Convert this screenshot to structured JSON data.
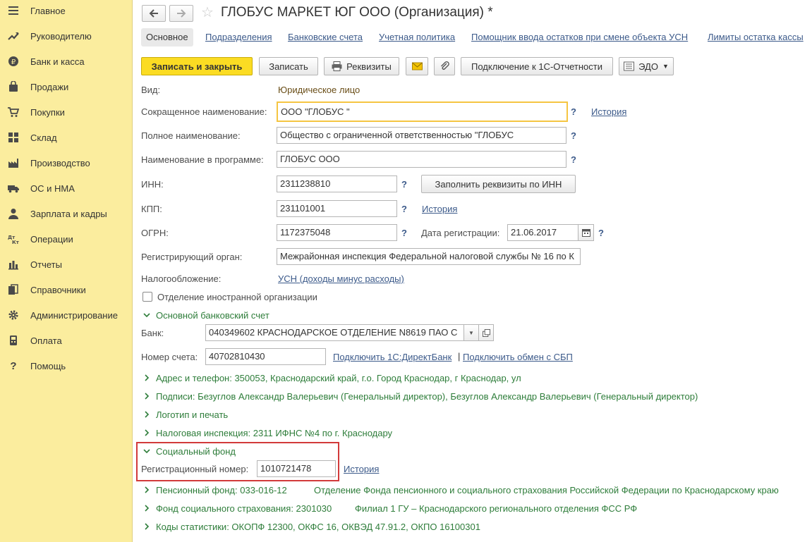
{
  "sidebar": {
    "items": [
      {
        "label": "Главное",
        "icon": "menu-icon"
      },
      {
        "label": "Руководителю",
        "icon": "trend-icon"
      },
      {
        "label": "Банк и касса",
        "icon": "ruble-coin-icon"
      },
      {
        "label": "Продажи",
        "icon": "shopping-bag-icon"
      },
      {
        "label": "Покупки",
        "icon": "cart-icon"
      },
      {
        "label": "Склад",
        "icon": "warehouse-grid-icon"
      },
      {
        "label": "Производство",
        "icon": "factory-icon"
      },
      {
        "label": "ОС и НМА",
        "icon": "truck-icon"
      },
      {
        "label": "Зарплата и кадры",
        "icon": "person-icon"
      },
      {
        "label": "Операции",
        "icon": "dt-kt-icon"
      },
      {
        "label": "Отчеты",
        "icon": "bar-chart-icon"
      },
      {
        "label": "Справочники",
        "icon": "books-icon"
      },
      {
        "label": "Администрирование",
        "icon": "gear-icon"
      },
      {
        "label": "Оплата",
        "icon": "terminal-icon"
      },
      {
        "label": "Помощь",
        "icon": "question-icon"
      }
    ]
  },
  "header": {
    "title": "ГЛОБУС МАРКЕТ ЮГ ООО (Организация) *"
  },
  "tabs": [
    "Основное",
    "Подразделения",
    "Банковские счета",
    "Учетная политика",
    "Помощник ввода остатков при смене объекта УСН",
    "Лимиты остатка кассы"
  ],
  "toolbar": {
    "save_close": "Записать и закрыть",
    "save": "Записать",
    "requisites": "Реквизиты",
    "connect_reporting": "Подключение к 1С-Отчетности",
    "edo": "ЭДО"
  },
  "form": {
    "type_label": "Вид:",
    "type_value": "Юридическое лицо",
    "short_name_label": "Сокращенное наименование:",
    "short_name_value": "ООО \"ГЛОБУС                    \"",
    "full_name_label": "Полное наименование:",
    "full_name_value": "Общество с ограниченной ответственностью \"ГЛОБУС",
    "prog_name_label": "Наименование в программе:",
    "prog_name_value": "ГЛОБУС                     ООО",
    "inn_label": "ИНН:",
    "inn_value": "2311238810",
    "fill_by_inn": "Заполнить реквизиты по ИНН",
    "kpp_label": "КПП:",
    "kpp_value": "231101001",
    "ogrn_label": "ОГРН:",
    "ogrn_value": "1172375048",
    "reg_date_label": "Дата регистрации:",
    "reg_date_value": "21.06.2017",
    "reg_org_label": "Регистрирующий орган:",
    "reg_org_value": "Межрайонная инспекция Федеральной налоговой службы № 16 по К",
    "tax_label": "Налогообложение:",
    "tax_value": "УСН (доходы минус расходы)",
    "foreign_label": "Отделение иностранной организации",
    "history": "История",
    "question": "?"
  },
  "bank_section": {
    "title": "Основной банковский счет",
    "bank_label": "Банк:",
    "bank_value": "040349602 КРАСНОДАРСКОЕ ОТДЕЛЕНИЕ N8619 ПАО С",
    "account_label": "Номер счета:",
    "account_value": "40702810430",
    "directbank_link": "Подключить 1С:ДиректБанк",
    "separator": "|",
    "sbp_link": "Подключить обмен с СБП"
  },
  "groups": {
    "address": "Адрес и телефон: 350053, Краснодарский край, г.о. Город Краснодар, г Краснодар, ул",
    "signatures": "Подписи: Безуглов Александр Валерьевич (Генеральный директор), Безуглов Александр Валерьевич (Генеральный директор)",
    "logo": "Логотип и печать",
    "tax_office": "Налоговая инспекция: 2311 ИФНС №4 по г. Краснодару",
    "social_fund": "Социальный фонд",
    "pension_fund": "Пенсионный фонд: 033-016-12",
    "pension_fund_detail": "Отделение Фонда пенсионного и социального страхования Российской Федерации по Краснодарскому краю",
    "fss": "Фонд социального страхования: 2301030",
    "fss_detail": "Филиал 1 ГУ – Краснодарского регионального отделения ФСС РФ",
    "stat_codes": "Коды статистики: ОКОПФ 12300, ОКФС 16, ОКВЭД 47.91.2, ОКПО 16100301"
  },
  "social_fund": {
    "reg_number_label": "Регистрационный номер:",
    "reg_number_value": "1010721478",
    "history": "История"
  },
  "colors": {
    "sidebar_bg": "#fbed9e",
    "primary_button": "#fbdc23",
    "link": "#3c5a8a",
    "group_green": "#2e7d3a",
    "highlight_frame": "#d23a3a"
  }
}
